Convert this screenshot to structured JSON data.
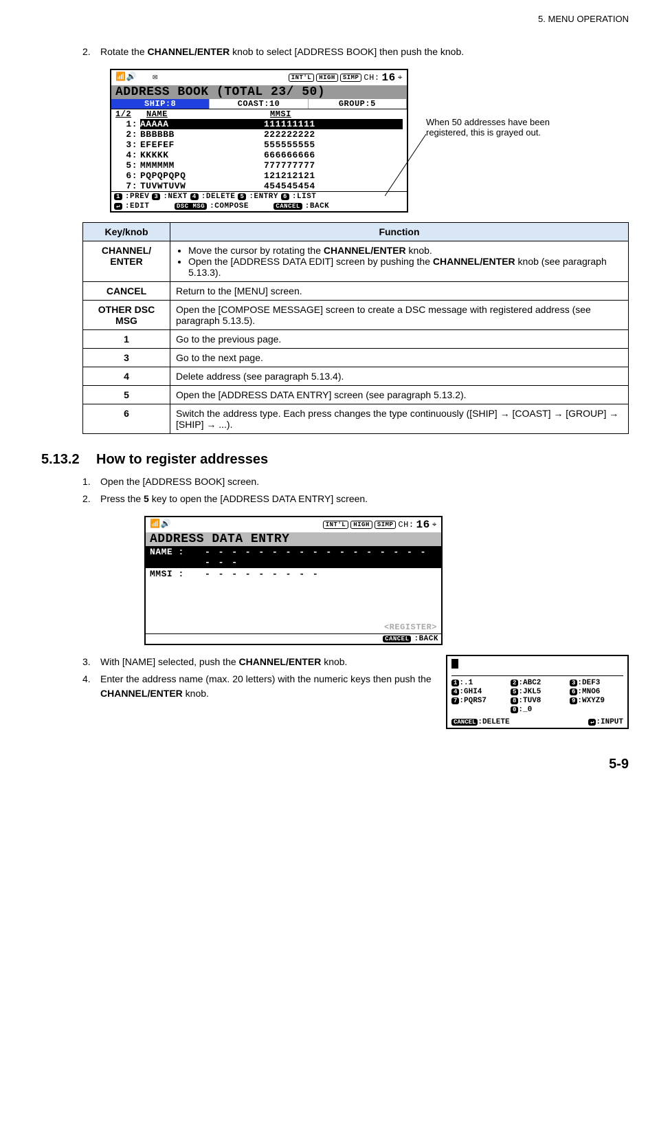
{
  "header": {
    "chapter": "5.  MENU OPERATION"
  },
  "step2": {
    "num": "2.",
    "text_a": "Rotate the ",
    "bold_a": "CHANNEL/ENTER",
    "text_b": " knob to select [ADDRESS BOOK] then push the knob."
  },
  "lcd1": {
    "top": {
      "intl": "INT'L",
      "high": "HIGH",
      "simp": "SIMP",
      "ch_label": "CH:",
      "ch": "16"
    },
    "title": "ADDRESS BOOK  (TOTAL  23/ 50)",
    "tabs": {
      "ship": "SHIP:8",
      "coast": "COAST:10",
      "group": "GROUP:5"
    },
    "head": {
      "page": "1/2",
      "name": "NAME",
      "mmsi": "MMSI"
    },
    "rows": [
      {
        "n": "1:",
        "name": "AAAAA",
        "mmsi": "111111111",
        "sel": true
      },
      {
        "n": "2:",
        "name": "BBBBBB",
        "mmsi": "222222222"
      },
      {
        "n": "3:",
        "name": "EFEFEF",
        "mmsi": "555555555"
      },
      {
        "n": "4:",
        "name": "KKKKK",
        "mmsi": "666666666"
      },
      {
        "n": "5:",
        "name": "MMMMMM",
        "mmsi": "777777777"
      },
      {
        "n": "6:",
        "name": "PQPQPQPQ",
        "mmsi": "121212121"
      },
      {
        "n": "7:",
        "name": "TUVWTUVW",
        "mmsi": "454545454"
      }
    ],
    "soft1": {
      "k1": "1",
      "t1": ":PREV",
      "k3": "3",
      "t3": ":NEXT",
      "k4": "4",
      "t4": ":DELETE",
      "k5": "5",
      "t5": ":ENTRY",
      "k6": "6",
      "t6": ":LIST"
    },
    "soft2": {
      "kenter": "↵",
      "tedit": ":EDIT",
      "kdsc": "DSC MSG",
      "tcompose": ":COMPOSE",
      "kcancel": "CANCEL",
      "tback": ":BACK"
    }
  },
  "callout": "When 50 addresses have been registered, this is grayed out.",
  "func_table": {
    "h1": "Key/knob",
    "h2": "Function",
    "rows": [
      {
        "k": "CHANNEL/ ENTER",
        "bullets": [
          {
            "pre": "Move the cursor by rotating the ",
            "b": "CHANNEL/ENTER",
            "post": " knob."
          },
          {
            "pre": "Open the [ADDRESS DATA EDIT] screen by pushing the ",
            "b": "CHANNEL/ENTER",
            "post": " knob (see paragraph 5.13.3)."
          }
        ]
      },
      {
        "k": "CANCEL",
        "f": "Return to the [MENU] screen."
      },
      {
        "k": "OTHER DSC MSG",
        "f": "Open the [COMPOSE MESSAGE] screen to create a DSC message with registered address (see paragraph 5.13.5)."
      },
      {
        "k": "1",
        "f": "Go to the previous page."
      },
      {
        "k": "3",
        "f": "Go to the next page."
      },
      {
        "k": "4",
        "f": "Delete address (see paragraph 5.13.4)."
      },
      {
        "k": "5",
        "f": "Open the [ADDRESS DATA ENTRY] screen (see paragraph 5.13.2)."
      },
      {
        "k": "6",
        "f": "Switch the address type. Each press changes the type continuously ([SHIP] → [COAST] → [GROUP] → [SHIP] → ...)."
      }
    ]
  },
  "section": {
    "num": "5.13.2",
    "title": "How to register addresses"
  },
  "steps_b": [
    {
      "n": "1.",
      "t": "Open the [ADDRESS BOOK] screen."
    },
    {
      "n": "2.",
      "pre": "Press the ",
      "b": "5",
      "post": " key to open the [ADDRESS DATA ENTRY] screen."
    }
  ],
  "lcd2": {
    "top": {
      "intl": "INT'L",
      "high": "HIGH",
      "simp": "SIMP",
      "ch_label": "CH:",
      "ch": "16"
    },
    "title": "ADDRESS DATA ENTRY",
    "rows": [
      {
        "lab": "NAME :",
        "val": "- - - - - - - - - - - - - - - - - - - -",
        "sel": true
      },
      {
        "lab": "MMSI :",
        "val": "- - - - - - - - -"
      }
    ],
    "register": "<REGISTER>",
    "soft": {
      "kcancel": "CANCEL",
      "tback": ":BACK"
    }
  },
  "step3": {
    "n": "3.",
    "pre": "With [NAME] selected, push the ",
    "b": "CHANNEL/ENTER",
    "post": " knob."
  },
  "step4": {
    "n": "4.",
    "pre": "Enter the address name (max. 20 letters) with the numeric keys then push the ",
    "b": "CHANNEL/ENTER",
    "post": " knob."
  },
  "keypad": {
    "keys": [
      {
        "k": "1",
        "t": ":.1"
      },
      {
        "k": "2",
        "t": ":ABC2"
      },
      {
        "k": "3",
        "t": ":DEF3"
      },
      {
        "k": "4",
        "t": ":GHI4"
      },
      {
        "k": "5",
        "t": ":JKL5"
      },
      {
        "k": "6",
        "t": ":MNO6"
      },
      {
        "k": "7",
        "t": ":PQRS7"
      },
      {
        "k": "8",
        "t": ":TUV8"
      },
      {
        "k": "9",
        "t": ":WXYZ9"
      },
      {
        "k": "",
        "t": ""
      },
      {
        "k": "0",
        "t": ":_0"
      },
      {
        "k": "",
        "t": ""
      }
    ],
    "cancel_k": "CANCEL",
    "cancel_t": ":DELETE",
    "enter_k": "↵",
    "enter_t": ":INPUT"
  },
  "footer": {
    "page": "5-9"
  }
}
